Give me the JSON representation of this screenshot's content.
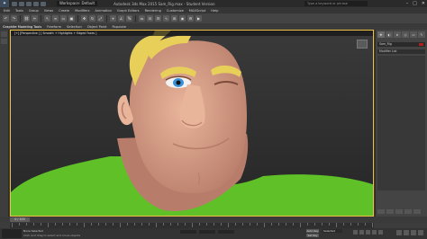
{
  "app": {
    "workspace_label": "Workspace: Default",
    "window_title": "Autodesk 3ds Max 2015  Sam_Rig.max  - Student Version",
    "search_placeholder": "Type a keyword or phrase"
  },
  "menubar": {
    "items": [
      "Edit",
      "Tools",
      "Group",
      "Views",
      "Create",
      "Modifiers",
      "Animation",
      "Graph Editors",
      "Rendering",
      "Customize",
      "MAXScript",
      "Help"
    ]
  },
  "ribbon": {
    "tabs": [
      "Graphite Modeling Tools",
      "Freeform",
      "Selection",
      "Object Paint",
      "Populate"
    ],
    "sub_label": "Default"
  },
  "viewport": {
    "label": "[+] [Perspective ] [ Smooth + Highlights + Edged Faces ]",
    "colors": {
      "background_top": "#3a3a3a",
      "background_bottom": "#262626",
      "skin": "#e8b49a",
      "skin_shadow": "#b87d6a",
      "hair": "#e8cf5a",
      "shirt": "#5fc028",
      "eye_iris": "#3a8fd8",
      "border_active": "#f0c040"
    }
  },
  "command_panel": {
    "object_name": "Sam_Rig",
    "modifier_list": "Modifier List",
    "tab_icons": [
      "create-icon",
      "modify-icon",
      "hierarchy-icon",
      "motion-icon",
      "display-icon",
      "utilities-icon"
    ]
  },
  "timeline": {
    "slider_label": "0 / 100",
    "ticks": [
      "0",
      "10",
      "20",
      "30",
      "40",
      "50",
      "60",
      "70",
      "80",
      "90",
      "100"
    ]
  },
  "statusbar": {
    "line1": "None Selected",
    "line2": "Click and drag to select and move objects",
    "auto_key": "Auto Key",
    "set_key": "Set Key",
    "selected_dropdown": "Selected"
  }
}
